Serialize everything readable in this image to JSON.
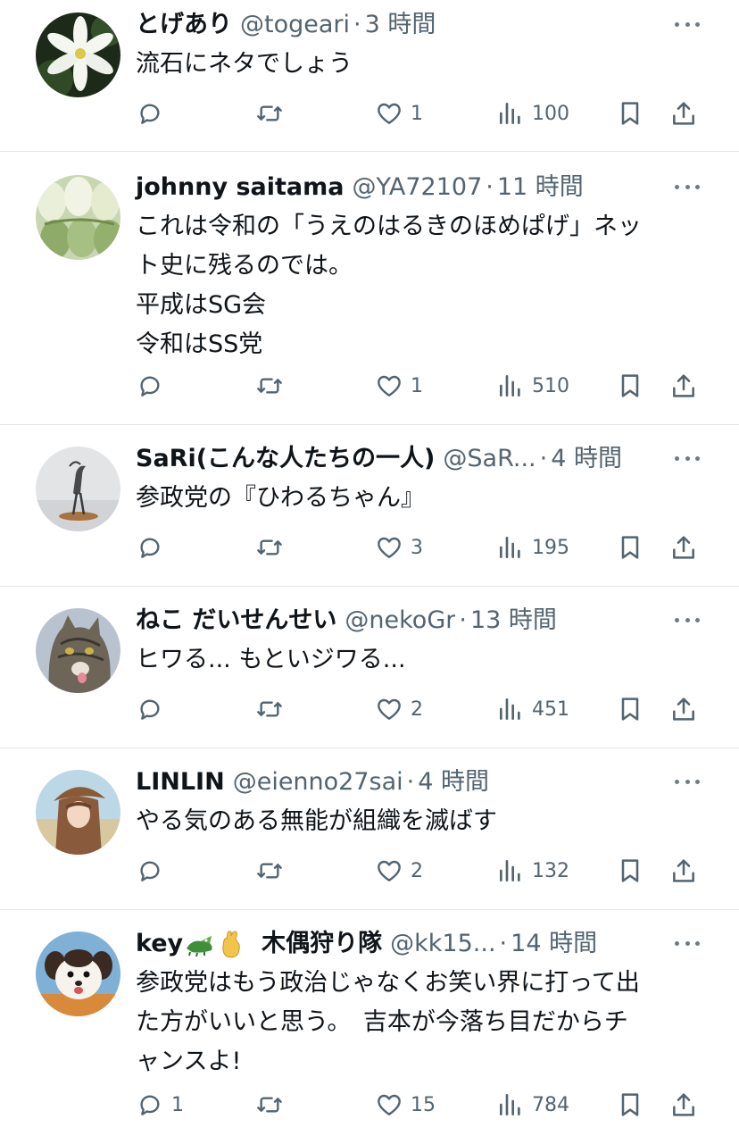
{
  "tweets": [
    {
      "name": "とげあり",
      "handle": "@togeari",
      "dot": "·",
      "time": "3 時間",
      "text": [
        "流石にネタでしょう"
      ],
      "replies": "",
      "likes": "1",
      "views": "100",
      "avatar_icon": "white-flower-avatar"
    },
    {
      "name": "johnny saitama",
      "handle": "@YA72107",
      "dot": "·",
      "time": "11 時間",
      "text": [
        "これは令和の「うえのはるきのほめぱげ」ネッ",
        "ト史に残るのでは。",
        "平成はSG会",
        "令和はSS党"
      ],
      "replies": "",
      "likes": "1",
      "views": "510",
      "avatar_icon": "cabbage-avatar"
    },
    {
      "name": "SaRi(こんな人たちの一人)",
      "handle": "@SaR...",
      "dot": "·",
      "time": "4 時間",
      "text": [
        "参政党の『ひわるちゃん』"
      ],
      "replies": "",
      "likes": "3",
      "views": "195",
      "avatar_icon": "bird-figurine-avatar"
    },
    {
      "name": "ねこ だいせんせい",
      "handle": "@nekoGr",
      "dot": "·",
      "time": "13 時間",
      "text": [
        "ヒワる... もといジワる..."
      ],
      "replies": "",
      "likes": "2",
      "views": "451",
      "avatar_icon": "cat-avatar"
    },
    {
      "name": "LINLIN",
      "handle": "@eienno27sai",
      "dot": "·",
      "time": "4 時間",
      "text": [
        "やる気のある無能が組織を滅ばす"
      ],
      "replies": "",
      "likes": "2",
      "views": "132",
      "avatar_icon": "anime-girl-avatar"
    },
    {
      "name": "key",
      "name_suffix": "木偶狩り隊",
      "handle": "@kk15...",
      "dot": "·",
      "time": "14 時間",
      "text": [
        "参政党はもう政治じゃなくお笑い界に打って出",
        "た方がいいと思う。　吉本が今落ち目だからチ",
        "ャンスよ!"
      ],
      "replies": "1",
      "likes": "15",
      "views": "784",
      "avatar_icon": "dog-avatar"
    }
  ],
  "icons": {
    "reply": "reply-icon",
    "retweet": "retweet-icon",
    "like": "heart-icon",
    "views": "views-chart-icon",
    "bookmark": "bookmark-icon",
    "share": "share-icon",
    "more": "more-dots-icon"
  },
  "colors": {
    "text": "#0f1419",
    "secondary": "#536471",
    "divider": "#e6e6e6"
  }
}
